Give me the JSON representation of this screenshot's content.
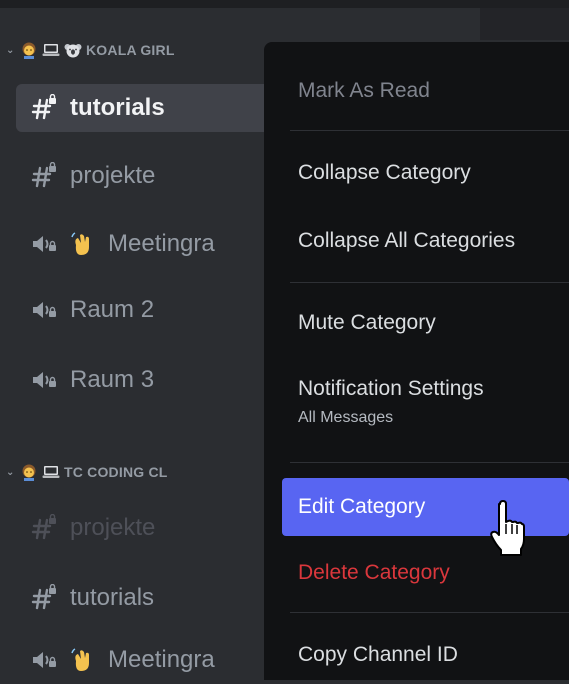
{
  "categories": [
    {
      "title": "KOALA GIRL",
      "emojis": [
        "person-emoji",
        "laptop-emoji",
        "koala-emoji"
      ]
    },
    {
      "title": "TC CODING CL",
      "emojis": [
        "person-emoji",
        "laptop-emoji"
      ]
    }
  ],
  "channels": [
    {
      "label": "tutorials",
      "type": "text",
      "state": "selected"
    },
    {
      "label": "projekte",
      "type": "text",
      "state": "normal"
    },
    {
      "label": "Meetingra",
      "type": "voice",
      "emoji": "waving-hand-emoji",
      "state": "normal"
    },
    {
      "label": "Raum 2",
      "type": "voice",
      "state": "normal"
    },
    {
      "label": "Raum 3",
      "type": "voice",
      "state": "normal"
    },
    {
      "label": "projekte",
      "type": "text",
      "state": "muted"
    },
    {
      "label": "tutorials",
      "type": "text",
      "state": "normal"
    },
    {
      "label": "Meetingra",
      "type": "voice",
      "emoji": "waving-hand-emoji",
      "state": "normal"
    }
  ],
  "context_menu": {
    "mark_as_read": "Mark As Read",
    "collapse_category": "Collapse Category",
    "collapse_all_categories": "Collapse All Categories",
    "mute_category": "Mute Category",
    "notification_settings": "Notification Settings",
    "notification_settings_value": "All Messages",
    "edit_category": "Edit Category",
    "delete_category": "Delete Category",
    "copy_channel_id": "Copy Channel ID"
  },
  "colors": {
    "sidebar_bg": "#2b2d31",
    "menu_bg": "#111214",
    "selected_bg": "#404249",
    "accent": "#5865f2",
    "danger": "#da373c",
    "text_muted": "#949ba4"
  },
  "icons": {
    "text_channel": "text-channel-locked-icon",
    "voice_channel": "voice-channel-locked-icon",
    "chevron": "chevron-down-icon",
    "cursor": "hand-pointer-cursor"
  }
}
